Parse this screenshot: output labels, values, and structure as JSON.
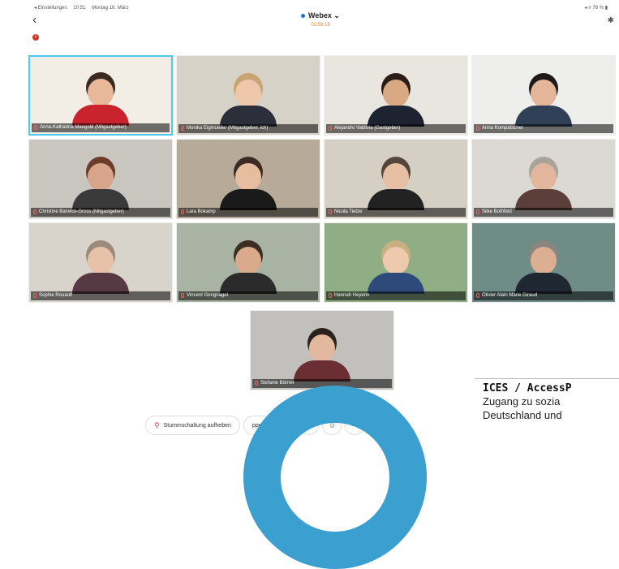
{
  "statusbar": {
    "left": [
      "◂ Einstellungen",
      "10:51",
      "Montag 16. März"
    ],
    "right": "◂ ⌾ 78 % ▮"
  },
  "header": {
    "app": "Webex",
    "timer": "01:59:16"
  },
  "participants": [
    {
      "name": "Anna-Katharina Mangold (Mitgastgeber)",
      "skin": "#e8b89a",
      "hair": "#3b2a22",
      "shirt": "#c9232d",
      "wall": "#f2eee6",
      "active": true
    },
    {
      "name": "Monika Eigmueller (Mitgastgeber, ich)",
      "skin": "#efc7ab",
      "hair": "#c8a472",
      "shirt": "#2c2f3a",
      "wall": "#d7d2c8"
    },
    {
      "name": "Alejandro Valdivia (Gastgeber)",
      "skin": "#d9a984",
      "hair": "#2b1d16",
      "shirt": "#1d2330",
      "wall": "#e9e6df"
    },
    {
      "name": "Anna Kompatscher",
      "skin": "#e3b69a",
      "hair": "#1d1a19",
      "shirt": "#304057",
      "wall": "#eeeeec"
    },
    {
      "name": "Christine Barwick-Gross (Mitgastgeber)",
      "skin": "#d8a58a",
      "hair": "#6b3c2a",
      "shirt": "#3a3a3a",
      "wall": "#c9c5bf"
    },
    {
      "name": "Lara Bokamp",
      "skin": "#e7bda0",
      "hair": "#3b2b22",
      "shirt": "#1a1a1a",
      "wall": "#b7aa98"
    },
    {
      "name": "Nicola Tietze",
      "skin": "#e6bfa4",
      "hair": "#54463a",
      "shirt": "#222222",
      "wall": "#d5cfc4"
    },
    {
      "name": "Silke Bothfeld",
      "skin": "#e2b69c",
      "hair": "#a9a39a",
      "shirt": "#5a3f3a",
      "wall": "#dcd9d4"
    },
    {
      "name": "Sophie Rouault",
      "skin": "#e8c2a8",
      "hair": "#9c8b7a",
      "shirt": "#563942",
      "wall": "#d8d3cb"
    },
    {
      "name": "Vincent Gengnagel",
      "skin": "#d9ab8c",
      "hair": "#3d2e24",
      "shirt": "#2b2b2b",
      "wall": "#a9b3a4"
    },
    {
      "name": "Hannah Heyenn",
      "skin": "#efc9ae",
      "hair": "#c9ae7f",
      "shirt": "#2d4a7a",
      "wall": "#8fae86"
    },
    {
      "name": "Olivier Alain Marie Giraud",
      "skin": "#dcae92",
      "hair": "#8a8580",
      "shirt": "#1f2733",
      "wall": "#6f8c86"
    },
    {
      "name": "Stefanie Börner",
      "skin": "#e2b89f",
      "hair": "#2b221d",
      "shirt": "#6a2e33",
      "wall": "#c2c0bc"
    }
  ],
  "toolbar": {
    "mute_label": "Stummschaltung aufheben",
    "video_label": "ppen"
  },
  "overlay": {
    "title": "ICES / AccessP",
    "lines": [
      "Zugang zu sozia",
      "Deutschland und"
    ]
  },
  "colors": {
    "accent": "#1a73e8",
    "ring": "#3b9fcf",
    "mic_muted": "#d93025",
    "timer": "#e0892b"
  }
}
